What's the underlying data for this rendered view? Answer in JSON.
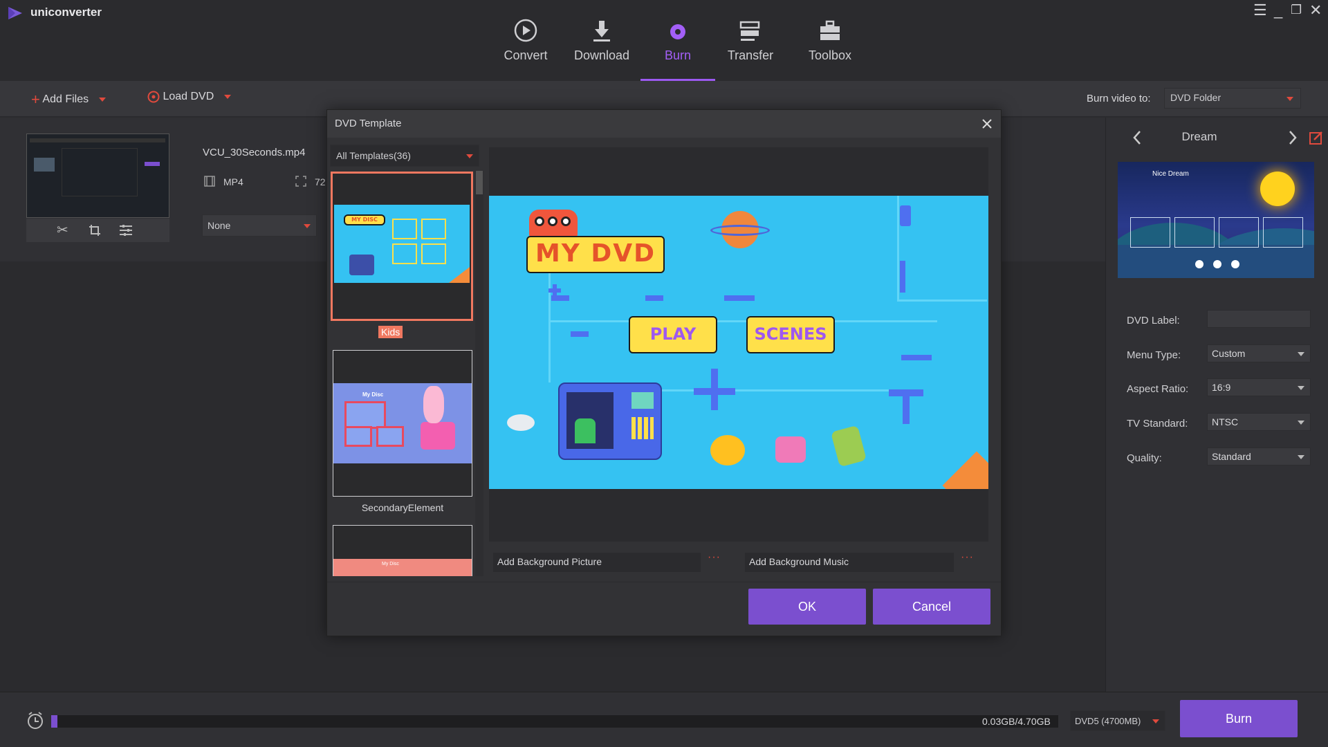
{
  "app": {
    "name": "uniconverter"
  },
  "nav": {
    "tabs": [
      {
        "label": "Convert"
      },
      {
        "label": "Download"
      },
      {
        "label": "Burn"
      },
      {
        "label": "Transfer"
      },
      {
        "label": "Toolbox"
      }
    ],
    "active": "Burn"
  },
  "toolbar": {
    "add_files": "Add Files",
    "load_dvd": "Load DVD",
    "burn_to_label": "Burn video to:",
    "burn_to_value": "DVD Folder"
  },
  "file": {
    "name": "VCU_30Seconds.mp4",
    "format": "MP4",
    "resolution": "72",
    "subtitle_select": "None"
  },
  "right_panel": {
    "template_name": "Dream",
    "preview_title": "Nice Dream",
    "dvd_label": {
      "label": "DVD Label:",
      "value": ""
    },
    "menu_type": {
      "label": "Menu Type:",
      "value": "Custom"
    },
    "aspect_ratio": {
      "label": "Aspect Ratio:",
      "value": "16:9"
    },
    "tv_standard": {
      "label": "TV Standard:",
      "value": "NTSC"
    },
    "quality": {
      "label": "Quality:",
      "value": "Standard"
    }
  },
  "modal": {
    "title": "DVD Template",
    "filter": "All Templates(36)",
    "templates": [
      {
        "label": "Kids",
        "selected": true,
        "disc_text": "MY DISC"
      },
      {
        "label": "SecondaryElement",
        "selected": false,
        "disc_text": "My Disc"
      },
      {
        "label": "",
        "selected": false,
        "disc_text": "My Disc"
      }
    ],
    "preview": {
      "title": "MY DVD",
      "play": "PLAY",
      "scenes": "SCENES"
    },
    "bg_picture": "Add Background Picture",
    "bg_music": "Add Background Music",
    "more": "···",
    "ok": "OK",
    "cancel": "Cancel"
  },
  "bottom": {
    "usage": "0.03GB/4.70GB",
    "usage_fraction": 0.006,
    "disc_type": "DVD5 (4700MB)",
    "burn": "Burn"
  },
  "colors": {
    "accent": "#7b4fcf",
    "active_tab": "#a35ff7",
    "selection": "#f07860",
    "sky": "#35c2f2"
  }
}
